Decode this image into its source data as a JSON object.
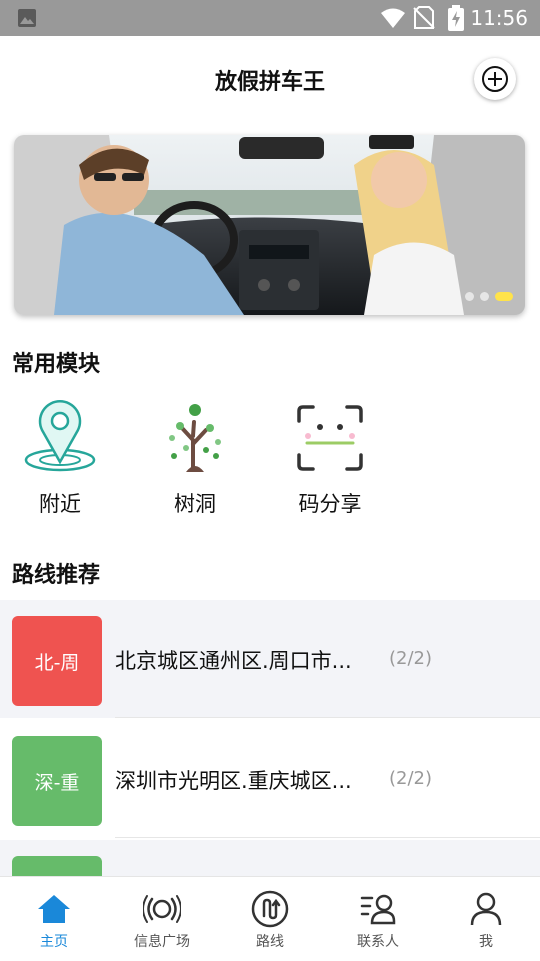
{
  "status_bar": {
    "time": "11:56",
    "icons": [
      "gallery-icon",
      "wifi-icon",
      "no-sim-icon",
      "battery-charging-icon"
    ]
  },
  "header": {
    "title": "放假拼车王",
    "add_icon": "plus-circle-icon"
  },
  "banner": {
    "image": "couple-in-car-photo",
    "page_count": 3,
    "active_page": 3
  },
  "modules": {
    "title": "常用模块",
    "items": [
      {
        "label": "附近",
        "icon": "location-pin-icon"
      },
      {
        "label": "树洞",
        "icon": "tree-icon"
      },
      {
        "label": "码分享",
        "icon": "scan-code-icon"
      }
    ]
  },
  "routes": {
    "title": "路线推荐",
    "items": [
      {
        "badge": "北-周",
        "badge_color": "#ef5350",
        "text": "北京城区通州区.周口市...",
        "count": "(2/2)"
      },
      {
        "badge": "深-重",
        "badge_color": "#66bb6a",
        "text": "深圳市光明区.重庆城区...",
        "count": "(2/2)"
      },
      {
        "badge": "",
        "badge_color": "#66bb6a",
        "text": "",
        "count": ""
      }
    ]
  },
  "tabbar": {
    "active": "主页",
    "active_color": "#1a88d9",
    "items": [
      {
        "label": "主页",
        "icon": "home-icon"
      },
      {
        "label": "信息广场",
        "icon": "broadcast-icon"
      },
      {
        "label": "路线",
        "icon": "route-icon"
      },
      {
        "label": "联系人",
        "icon": "contacts-icon"
      },
      {
        "label": "我",
        "icon": "user-icon"
      }
    ]
  }
}
